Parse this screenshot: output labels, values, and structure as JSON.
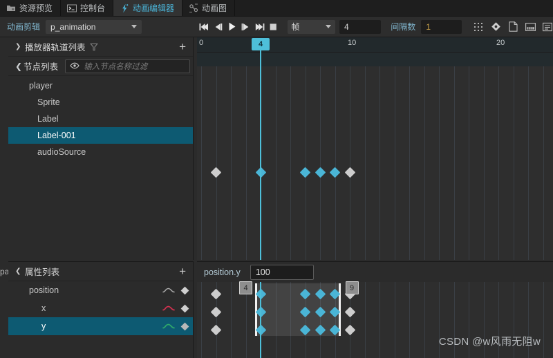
{
  "tabs": [
    {
      "label": "资源预览",
      "icon": "folder-icon",
      "active": false
    },
    {
      "label": "控制台",
      "icon": "console-icon",
      "active": false
    },
    {
      "label": "动画编辑器",
      "icon": "animation-icon",
      "active": true
    },
    {
      "label": "动画图",
      "icon": "animation-graph-icon",
      "active": false
    }
  ],
  "toolbar": {
    "clip_label": "动画剪辑",
    "clip_value": "p_animation",
    "transport": [
      {
        "name": "skip-to-start-icon"
      },
      {
        "name": "step-backward-icon"
      },
      {
        "name": "play-icon"
      },
      {
        "name": "step-forward-icon"
      },
      {
        "name": "skip-to-end-icon"
      },
      {
        "name": "stop-icon"
      }
    ],
    "unit_value": "帧",
    "frame_value": "4",
    "interval_label": "间隔数",
    "interval_value": "1",
    "tool_icons": [
      "dot-grid-icon",
      "diamond-move-icon",
      "file-icon",
      "keyboard-icon",
      "list-icon"
    ]
  },
  "track_panel": {
    "title": "播放器轨道列表",
    "add_label": "+"
  },
  "node_panel": {
    "title": "节点列表",
    "filter_placeholder": "输入节点名称过滤",
    "nodes": [
      {
        "label": "player",
        "level": 0,
        "selected": false
      },
      {
        "label": "Sprite",
        "level": 1,
        "selected": false
      },
      {
        "label": "Label",
        "level": 1,
        "selected": false
      },
      {
        "label": "Label-001",
        "level": 1,
        "selected": true
      },
      {
        "label": "audioSource",
        "level": 1,
        "selected": false
      }
    ]
  },
  "property_panel": {
    "title": "属性列表",
    "add_label": "+",
    "edge_text": "pa",
    "rows": [
      {
        "label": "position",
        "indent": 1,
        "selected": false,
        "curve_color": "#a8a8a8"
      },
      {
        "label": "x",
        "indent": 2,
        "selected": false,
        "curve_color": "#d0314f"
      },
      {
        "label": "y",
        "indent": 2,
        "selected": true,
        "curve_color": "#2fa86a"
      }
    ]
  },
  "timeline": {
    "ruler_ticks": [
      {
        "label": "0",
        "frame": 0
      },
      {
        "label": "10",
        "frame": 10
      },
      {
        "label": "20",
        "frame": 20
      }
    ],
    "playhead_frame": 4,
    "playhead_label": "4",
    "frame_width": 21.5,
    "grid_frames": 24,
    "upper_keyframes": [
      {
        "frame": 1,
        "color": "gray"
      },
      {
        "frame": 4,
        "color": "cyan"
      },
      {
        "frame": 7,
        "color": "cyan"
      },
      {
        "frame": 8,
        "color": "cyan"
      },
      {
        "frame": 9,
        "color": "cyan"
      },
      {
        "frame": 10,
        "color": "gray"
      }
    ],
    "property_value_label": "position.y",
    "property_value": "100",
    "selection_start_label": "4",
    "selection_end_label": "9",
    "lanes": [
      {
        "name": "position",
        "keyframes": [
          {
            "frame": 1,
            "color": "gray"
          },
          {
            "frame": 4,
            "color": "cyan"
          },
          {
            "frame": 7,
            "color": "cyan"
          },
          {
            "frame": 8,
            "color": "cyan"
          },
          {
            "frame": 9,
            "color": "cyan"
          },
          {
            "frame": 10,
            "color": "gray"
          }
        ]
      },
      {
        "name": "x",
        "keyframes": [
          {
            "frame": 1,
            "color": "gray"
          },
          {
            "frame": 4,
            "color": "cyan"
          },
          {
            "frame": 7,
            "color": "cyan"
          },
          {
            "frame": 8,
            "color": "cyan"
          },
          {
            "frame": 9,
            "color": "cyan"
          },
          {
            "frame": 10,
            "color": "gray"
          }
        ]
      },
      {
        "name": "y",
        "keyframes": [
          {
            "frame": 1,
            "color": "gray"
          },
          {
            "frame": 4,
            "color": "cyan"
          },
          {
            "frame": 7,
            "color": "cyan"
          },
          {
            "frame": 8,
            "color": "cyan"
          },
          {
            "frame": 9,
            "color": "cyan"
          },
          {
            "frame": 10,
            "color": "gray"
          }
        ]
      }
    ]
  },
  "watermark": "CSDN @w风雨无阻w",
  "colors": {
    "accent": "#4ebfd9",
    "selection": "#0d5a72",
    "keyframe_cyan": "#4ab5d6",
    "keyframe_gray": "#cdcdcd"
  }
}
